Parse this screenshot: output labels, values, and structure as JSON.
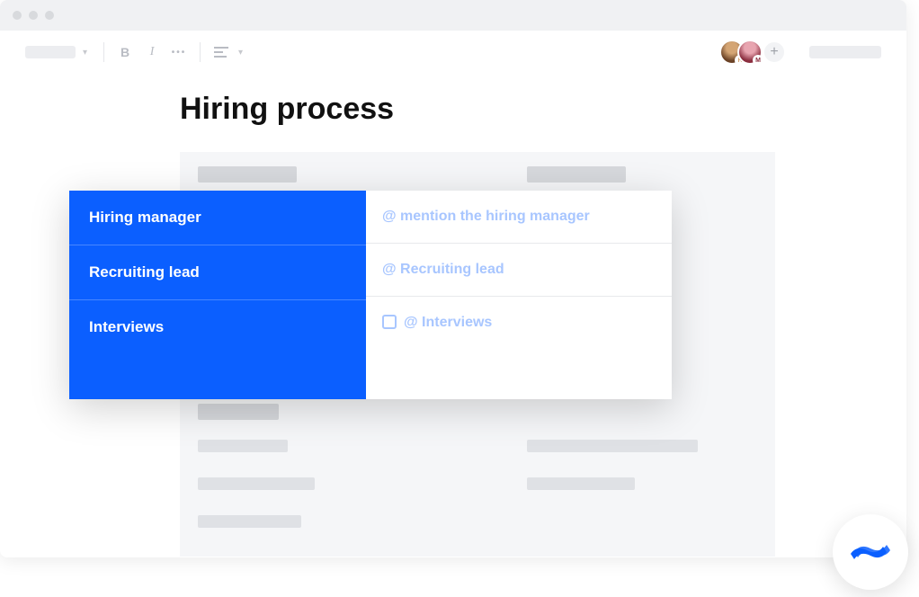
{
  "page": {
    "title": "Hiring process"
  },
  "toolbar": {
    "bold": "B",
    "italic": "I",
    "more": "•••"
  },
  "collaborators": [
    {
      "initial": "R",
      "color1": "#6b4226",
      "color2": "#d4a574"
    },
    {
      "initial": "M",
      "color1": "#8b2e3f",
      "color2": "#e8a5b0"
    }
  ],
  "table": {
    "rows": [
      {
        "label": "Hiring manager",
        "placeholder": "@ mention the hiring manager",
        "checkbox": false
      },
      {
        "label": "Recruiting lead",
        "placeholder": "@ Recruiting lead",
        "checkbox": false
      },
      {
        "label": "Interviews",
        "placeholder": "@ Interviews",
        "checkbox": true
      }
    ]
  },
  "colors": {
    "accent": "#0b5fff",
    "placeholder": "#a8c6ff"
  }
}
